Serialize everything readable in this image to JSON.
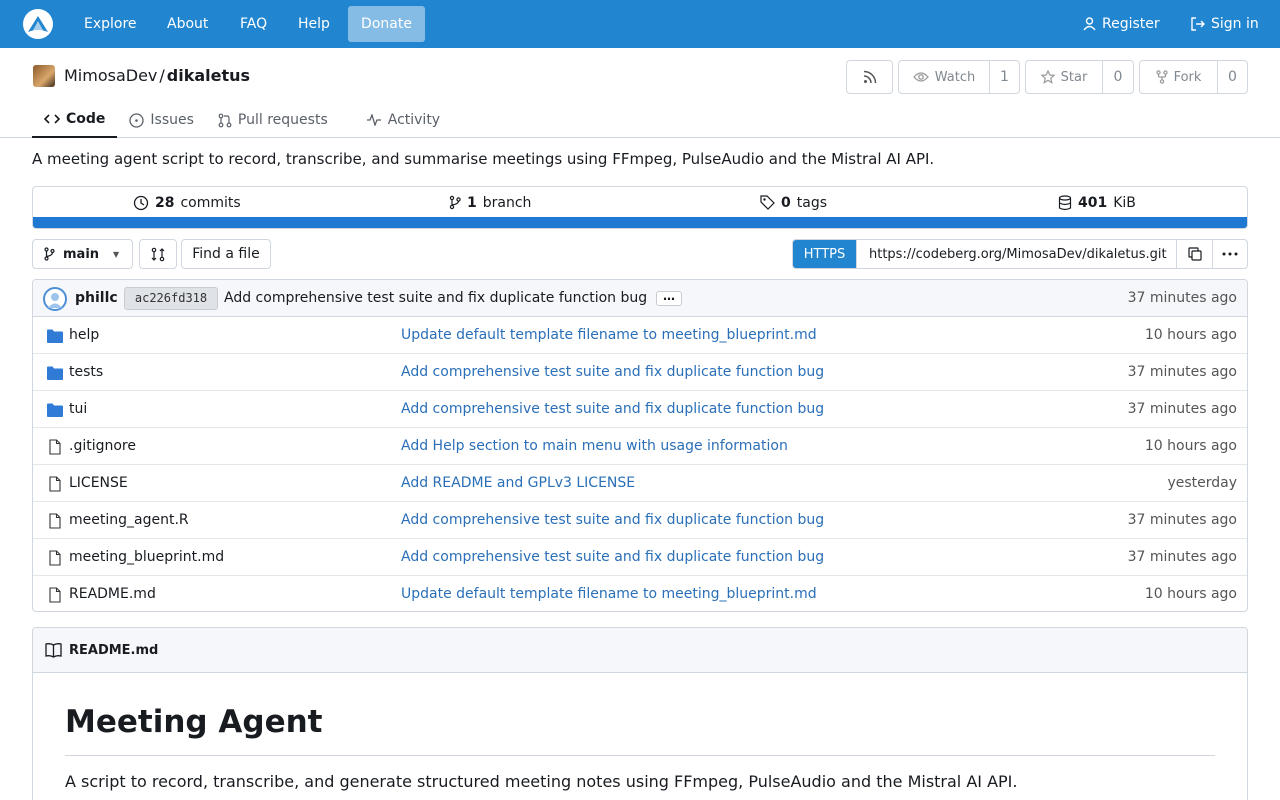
{
  "nav": {
    "links": [
      "Explore",
      "About",
      "FAQ",
      "Help"
    ],
    "donate": "Donate",
    "register": "Register",
    "signin": "Sign in"
  },
  "repo": {
    "owner": "MimosaDev",
    "separator": "/",
    "name": "dikaletus",
    "watch_label": "Watch",
    "watch_count": "1",
    "star_label": "Star",
    "star_count": "0",
    "fork_label": "Fork",
    "fork_count": "0",
    "description": "A meeting agent script to record, transcribe, and summarise meetings using FFmpeg, PulseAudio and the Mistral AI API."
  },
  "tabs": [
    {
      "label": "Code",
      "icon": "code-icon",
      "active": true
    },
    {
      "label": "Issues",
      "icon": "issue-icon",
      "active": false
    },
    {
      "label": "Pull requests",
      "icon": "pull-request-icon",
      "active": false
    },
    {
      "label": "Activity",
      "icon": "pulse-icon",
      "active": false
    }
  ],
  "stats": {
    "commits_count": "28",
    "commits_label": "commits",
    "branch_count": "1",
    "branch_label": "branch",
    "tags_count": "0",
    "tags_label": "tags",
    "size_value": "401",
    "size_unit": "KiB",
    "language_color": "#1f78d1"
  },
  "toolbar": {
    "branch": "main",
    "find_file": "Find a file",
    "protocol": "HTTPS",
    "clone_url": "https://codeberg.org/MimosaDev/dikaletus.git"
  },
  "latest_commit": {
    "author": "phillc",
    "sha": "ac226fd318",
    "message": "Add comprehensive test suite and fix duplicate function bug",
    "ellipsis": "…",
    "time": "37 minutes ago"
  },
  "files": [
    {
      "name": "help",
      "type": "folder",
      "message": "Update default template filename to meeting_blueprint.md",
      "time": "10 hours ago"
    },
    {
      "name": "tests",
      "type": "folder",
      "message": "Add comprehensive test suite and fix duplicate function bug",
      "time": "37 minutes ago"
    },
    {
      "name": "tui",
      "type": "folder",
      "message": "Add comprehensive test suite and fix duplicate function bug",
      "time": "37 minutes ago"
    },
    {
      "name": ".gitignore",
      "type": "file",
      "message": "Add Help section to main menu with usage information",
      "time": "10 hours ago"
    },
    {
      "name": "LICENSE",
      "type": "file",
      "message": "Add README and GPLv3 LICENSE",
      "time": "yesterday"
    },
    {
      "name": "meeting_agent.R",
      "type": "file",
      "message": "Add comprehensive test suite and fix duplicate function bug",
      "time": "37 minutes ago"
    },
    {
      "name": "meeting_blueprint.md",
      "type": "file",
      "message": "Add comprehensive test suite and fix duplicate function bug",
      "time": "37 minutes ago"
    },
    {
      "name": "README.md",
      "type": "file",
      "message": "Update default template filename to meeting_blueprint.md",
      "time": "10 hours ago"
    }
  ],
  "readme": {
    "filename": "README.md",
    "heading": "Meeting Agent",
    "intro": "A script to record, transcribe, and generate structured meeting notes using FFmpeg, PulseAudio and the Mistral AI API."
  },
  "colors": {
    "nav_bg": "#2185d0",
    "link": "#2a6fb8",
    "folder": "#2f7bd6"
  }
}
